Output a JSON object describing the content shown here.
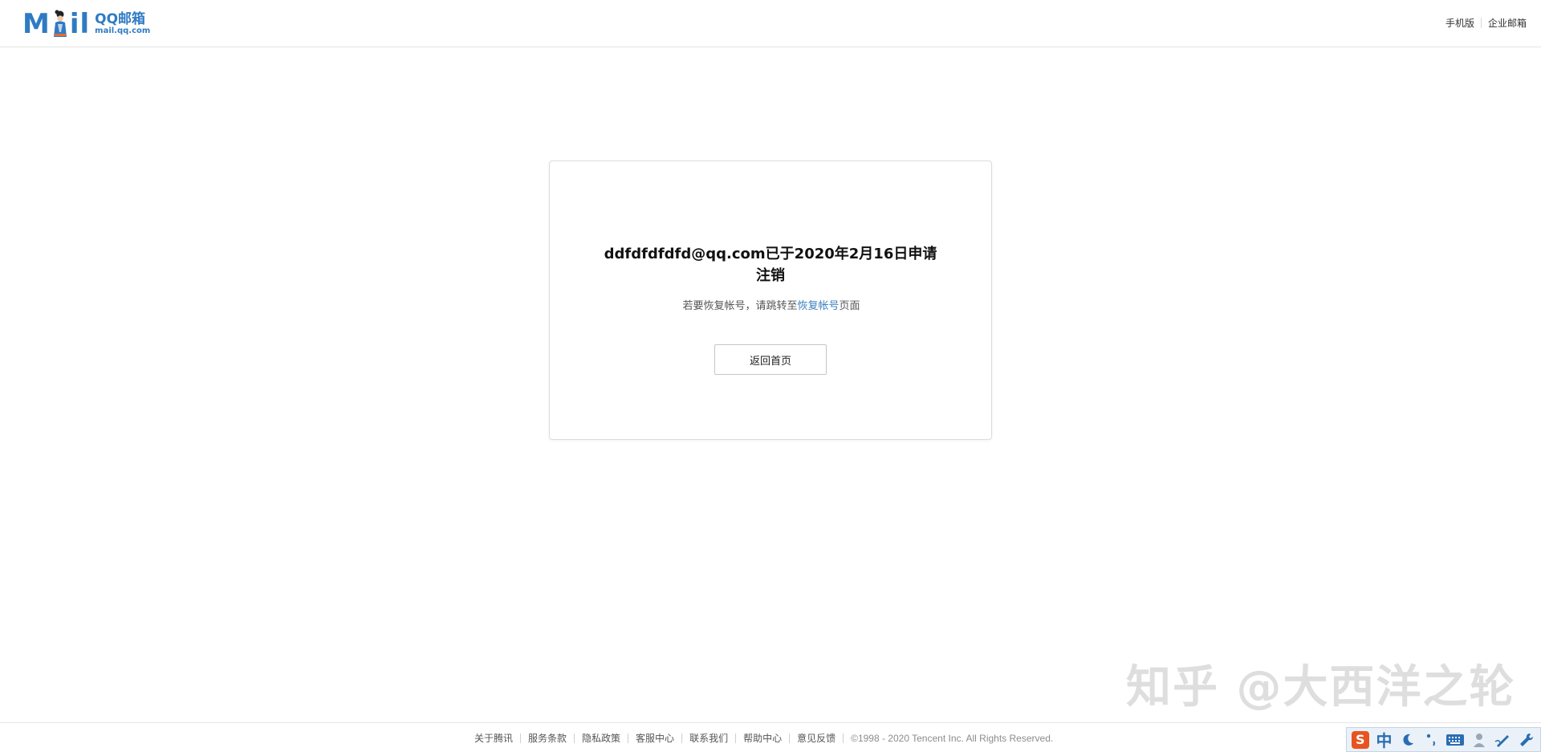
{
  "header": {
    "logo_word": "Mail",
    "logo_cn": "QQ邮箱",
    "logo_domain": "mail.qq.com",
    "links": [
      {
        "label": "手机版"
      },
      {
        "label": "企业邮箱"
      }
    ]
  },
  "card": {
    "title": "ddfdfdfdfd@qq.com已于2020年2月16日申请注销",
    "sub_prefix": "若要恢复帐号，请跳转至",
    "sub_link": "恢复帐号",
    "sub_suffix": "页面",
    "button_label": "返回首页"
  },
  "watermark": "知乎 @大西洋之轮",
  "footer": {
    "links": [
      {
        "label": "关于腾讯"
      },
      {
        "label": "服务条款"
      },
      {
        "label": "隐私政策"
      },
      {
        "label": "客服中心"
      },
      {
        "label": "联系我们"
      },
      {
        "label": "帮助中心"
      },
      {
        "label": "意见反馈"
      }
    ],
    "copyright": "©1998 - 2020 Tencent Inc. All Rights Reserved."
  },
  "ime_toolbar": {
    "logo_letter": "S",
    "mode_label": "中",
    "icons": [
      "sogou-logo-icon",
      "chinese-mode-icon",
      "moon-icon",
      "punctuation-icon",
      "keyboard-icon",
      "user-icon",
      "pen-icon",
      "wrench-icon"
    ]
  },
  "colors": {
    "brand_blue": "#2f7bc3",
    "link_blue": "#3b7fc4",
    "ime_orange": "#e8541f"
  }
}
